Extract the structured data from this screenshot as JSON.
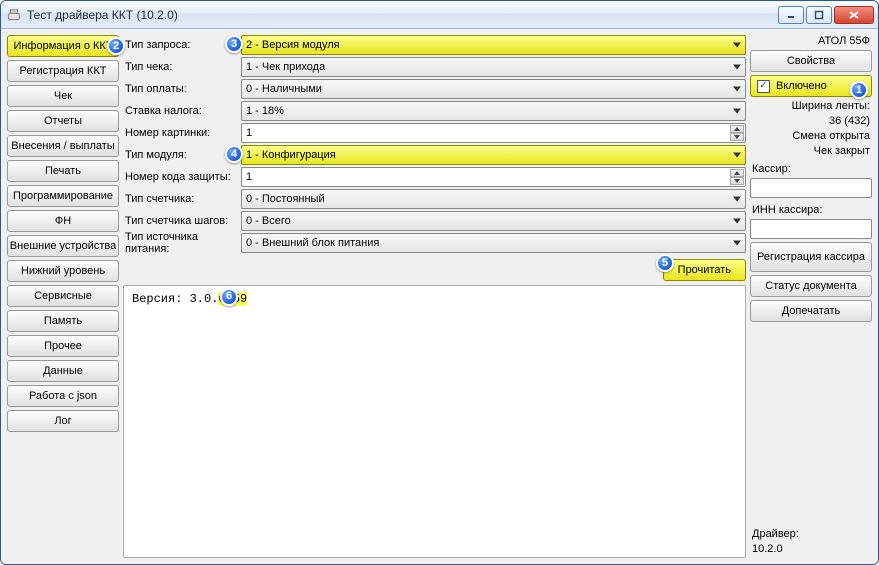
{
  "window": {
    "title": "Тест драйвера ККТ (10.2.0)"
  },
  "nav": {
    "items": [
      "Информация о ККТ",
      "Регистрация ККТ",
      "Чек",
      "Отчеты",
      "Внесения / выплаты",
      "Печать",
      "Программирование",
      "ФН",
      "Внешние устройства",
      "Нижний уровень",
      "Сервисные",
      "Память",
      "Прочее",
      "Данные",
      "Работа с json",
      "Лог"
    ]
  },
  "form": {
    "request_type_label": "Тип запроса:",
    "request_type_value": "2 - Версия модуля",
    "receipt_type_label": "Тип чека:",
    "receipt_type_value": "1 - Чек прихода",
    "payment_type_label": "Тип оплаты:",
    "payment_type_value": "0 - Наличными",
    "tax_rate_label": "Ставка налога:",
    "tax_rate_value": "1 - 18%",
    "picture_no_label": "Номер картинки:",
    "picture_no_value": "1",
    "module_type_label": "Тип модуля:",
    "module_type_value": "1 - Конфигурация",
    "protection_code_label": "Номер кода защиты:",
    "protection_code_value": "1",
    "counter_type_label": "Тип счетчика:",
    "counter_type_value": "0 - Постоянный",
    "step_counter_label": "Тип счетчика шагов:",
    "step_counter_value": "0 - Всего",
    "power_source_label": "Тип источника питания:",
    "power_source_value": "0 - Внешний блок питания",
    "read_button": "Прочитать"
  },
  "output": {
    "prefix": "Версия: 3.0.",
    "highlight": "6059"
  },
  "right": {
    "device_model": "АТОЛ 55Ф",
    "properties_btn": "Свойства",
    "enabled_label": "Включено",
    "tape_width_label": "Ширина ленты:",
    "tape_width_value": "36 (432)",
    "shift_state": "Смена открыта",
    "receipt_state": "Чек закрыт",
    "cashier_label": "Кассир:",
    "cashier_inn_label": "ИНН кассира:",
    "register_cashier_btn": "Регистрация кассира",
    "doc_status_btn": "Статус документа",
    "reprint_btn": "Допечатать",
    "driver_label": "Драйвер:",
    "driver_version": "10.2.0"
  },
  "callouts": {
    "c1": "1",
    "c2": "2",
    "c3": "3",
    "c4": "4",
    "c5": "5",
    "c6": "6"
  }
}
